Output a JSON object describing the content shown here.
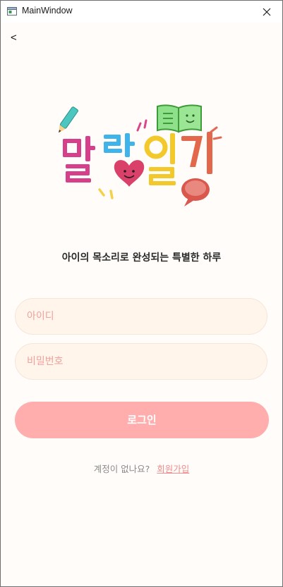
{
  "window": {
    "title": "MainWindow"
  },
  "nav": {
    "back_label": "<"
  },
  "logo": {
    "text": "말랑일기"
  },
  "tagline": "아이의 목소리로 완성되는 특별한 하루",
  "form": {
    "id_placeholder": "아이디",
    "password_placeholder": "비밀번호",
    "login_label": "로그인"
  },
  "signup": {
    "question": "계정이 없나요?",
    "link_label": "회원가입"
  },
  "colors": {
    "background": "#fffcf9",
    "field_bg": "#fff5eb",
    "placeholder": "#f2a09c",
    "login_button": "#ffadad",
    "link": "#f08c8c"
  },
  "icons": {
    "app": "window-app-icon",
    "close": "close-icon",
    "back": "back-chevron-icon"
  }
}
